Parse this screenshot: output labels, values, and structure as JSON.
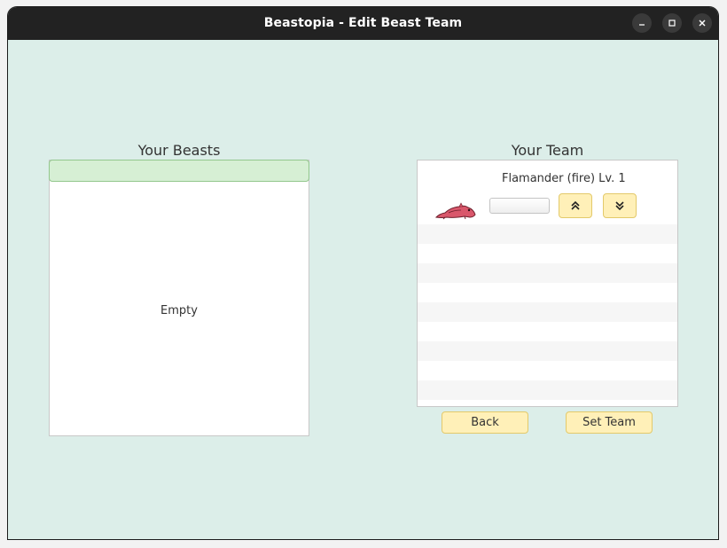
{
  "window": {
    "title": "Beastopia - Edit Beast Team",
    "controls": {
      "minimize_icon": "minimize-icon",
      "maximize_icon": "maximize-icon",
      "close_icon": "close-icon"
    }
  },
  "beasts_panel": {
    "heading": "Your Beasts",
    "empty_text": "Empty"
  },
  "team_panel": {
    "heading": "Your Team",
    "members": [
      {
        "label": "Flamander (fire) Lv. 1",
        "sprite_icon": "flamander-sprite-icon",
        "move_up_icon": "double-chevron-up-icon",
        "move_down_icon": "double-chevron-down-icon"
      }
    ]
  },
  "actions": {
    "back_label": "Back",
    "set_team_label": "Set Team"
  },
  "colors": {
    "background": "#dceee9",
    "titlebar": "#222222",
    "button_fill": "#fff0b8",
    "button_border": "#e3c96a",
    "selection_header": "#d6efd4"
  }
}
